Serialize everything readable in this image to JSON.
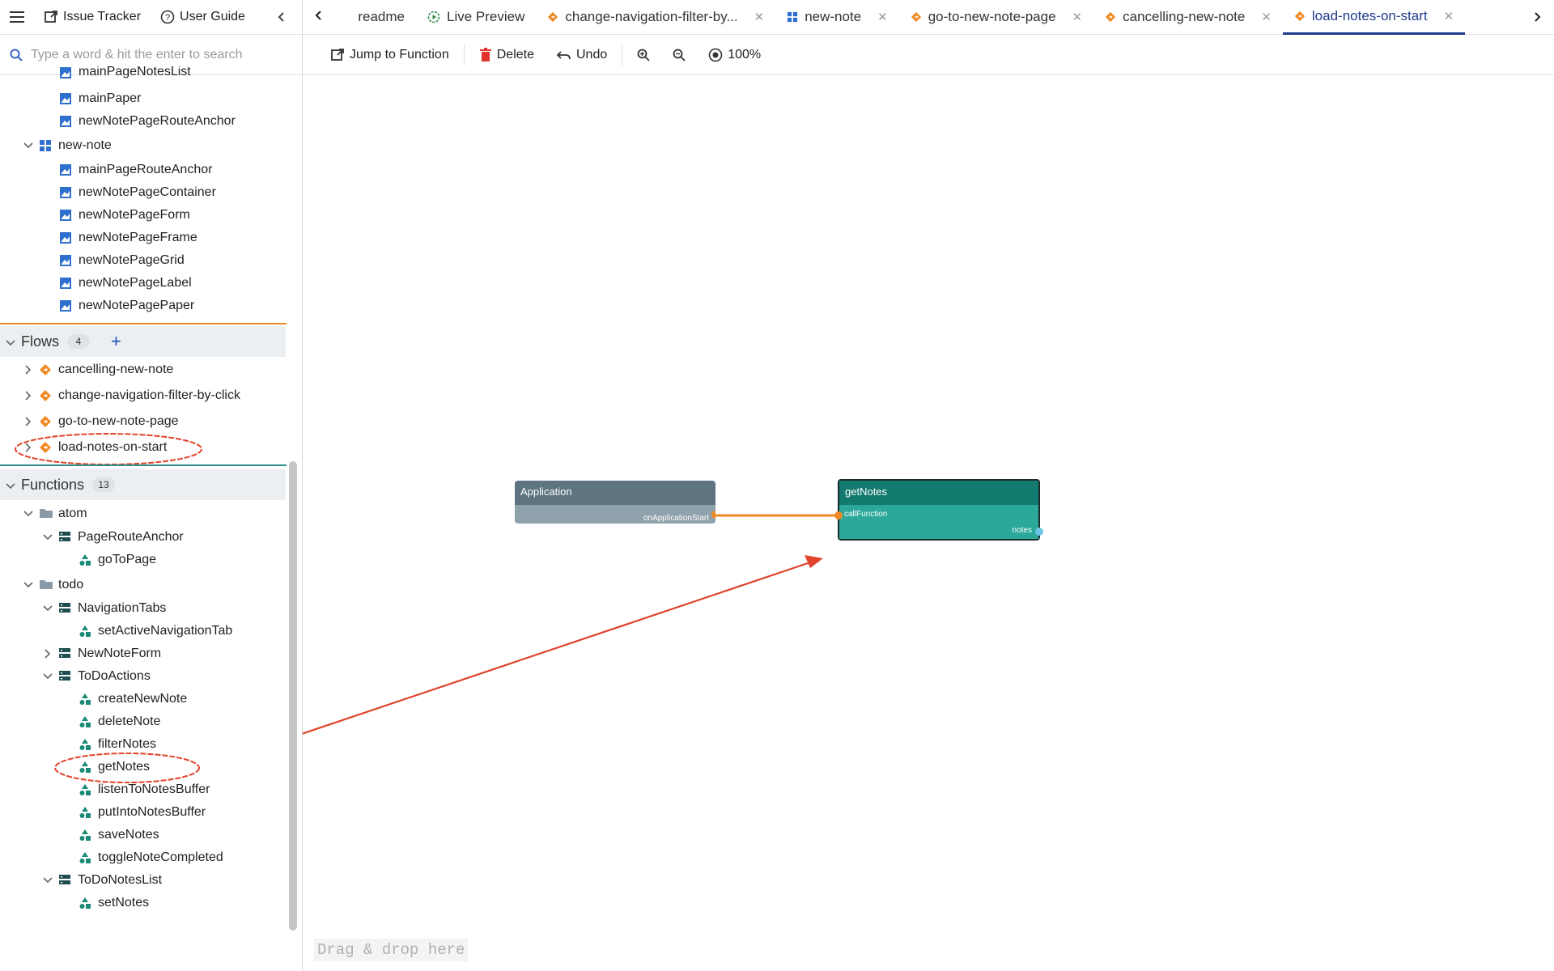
{
  "sidebar": {
    "issue_tracker": "Issue Tracker",
    "user_guide": "User Guide",
    "search_placeholder": "Type a word & hit the enter to search",
    "main_page_items": [
      "mainPageNotesList",
      "mainPaper",
      "newNotePageRouteAnchor"
    ],
    "new_note": {
      "label": "new-note",
      "items": [
        "mainPageRouteAnchor",
        "newNotePageContainer",
        "newNotePageForm",
        "newNotePageFrame",
        "newNotePageGrid",
        "newNotePageLabel",
        "newNotePagePaper"
      ]
    },
    "flows": {
      "title": "Flows",
      "count": "4",
      "add": "+",
      "items": [
        "cancelling-new-note",
        "change-navigation-filter-by-click",
        "go-to-new-note-page",
        "load-notes-on-start"
      ]
    },
    "functions": {
      "title": "Functions",
      "count": "13",
      "atom": {
        "label": "atom",
        "page_route_anchor": "PageRouteAnchor",
        "go_to_page": "goToPage"
      },
      "todo": {
        "label": "todo",
        "navigation_tabs": "NavigationTabs",
        "set_active_navigation_tab": "setActiveNavigationTab",
        "new_note_form": "NewNoteForm",
        "todo_actions": "ToDoActions",
        "actions": [
          "createNewNote",
          "deleteNote",
          "filterNotes",
          "getNotes",
          "listenToNotesBuffer",
          "putIntoNotesBuffer",
          "saveNotes",
          "toggleNoteCompleted"
        ],
        "todo_notes_list": "ToDoNotesList",
        "set_notes": "setNotes"
      }
    }
  },
  "tabs": [
    {
      "label": "readme",
      "icon": "none",
      "close": false
    },
    {
      "label": "Live Preview",
      "icon": "live-preview-icon",
      "close": false
    },
    {
      "label": "change-navigation-filter-by...",
      "icon": "flow-icon",
      "close": true
    },
    {
      "label": "new-note",
      "icon": "page-icon",
      "close": true
    },
    {
      "label": "go-to-new-note-page",
      "icon": "flow-icon",
      "close": true
    },
    {
      "label": "cancelling-new-note",
      "icon": "flow-icon",
      "close": true
    },
    {
      "label": "load-notes-on-start",
      "icon": "flow-icon",
      "close": true,
      "active": true
    }
  ],
  "toolbar": {
    "jump": "Jump to Function",
    "delete": "Delete",
    "undo": "Undo",
    "zoom": "100%"
  },
  "canvas": {
    "app_node": {
      "title": "Application",
      "output": "onApplicationStart"
    },
    "func_node": {
      "title": "getNotes",
      "input": "callFunction",
      "output": "notes"
    },
    "drop_hint": "Drag & drop here"
  },
  "colors": {
    "flow_icon": "#f08a24",
    "func_icon": "#1a8a78",
    "page_icon": "#2f6fd0",
    "active_tab": "#1e3c8c",
    "app_node_header": "#5f7481",
    "app_node_body": "#8fa1ab",
    "func_node_header": "#127a6e",
    "func_node_body": "#2ba89a",
    "connection": "#f08a24",
    "annotation": "#e0432b"
  }
}
